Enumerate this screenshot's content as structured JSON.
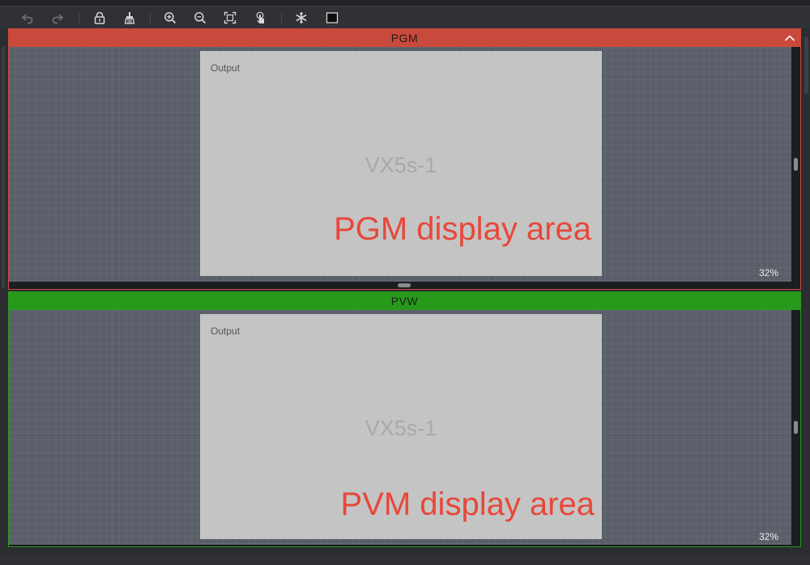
{
  "toolbar": {
    "buttons": [
      {
        "icon": "undo-icon"
      },
      {
        "icon": "redo-icon"
      },
      {
        "icon": "lock-icon"
      },
      {
        "icon": "clear-brush-icon"
      },
      {
        "icon": "zoom-in-icon"
      },
      {
        "icon": "zoom-out-icon"
      },
      {
        "icon": "fit-screen-icon"
      },
      {
        "icon": "touch-icon"
      },
      {
        "icon": "freeze-icon"
      },
      {
        "icon": "black-screen-icon"
      }
    ]
  },
  "pgm": {
    "title": "PGM",
    "output_label": "Output",
    "screen_name": "VX5s-1",
    "annotation": "PGM display area",
    "zoom": "32%",
    "color": "#c94a3c"
  },
  "pvw": {
    "title": "PVW",
    "output_label": "Output",
    "screen_name": "VX5s-1",
    "annotation": "PVM display area",
    "zoom": "32%",
    "color": "#279a1c"
  },
  "colors": {
    "annotation": "#e8473a",
    "canvas": "#5a5e68",
    "output_box": "#c4c4c4"
  }
}
